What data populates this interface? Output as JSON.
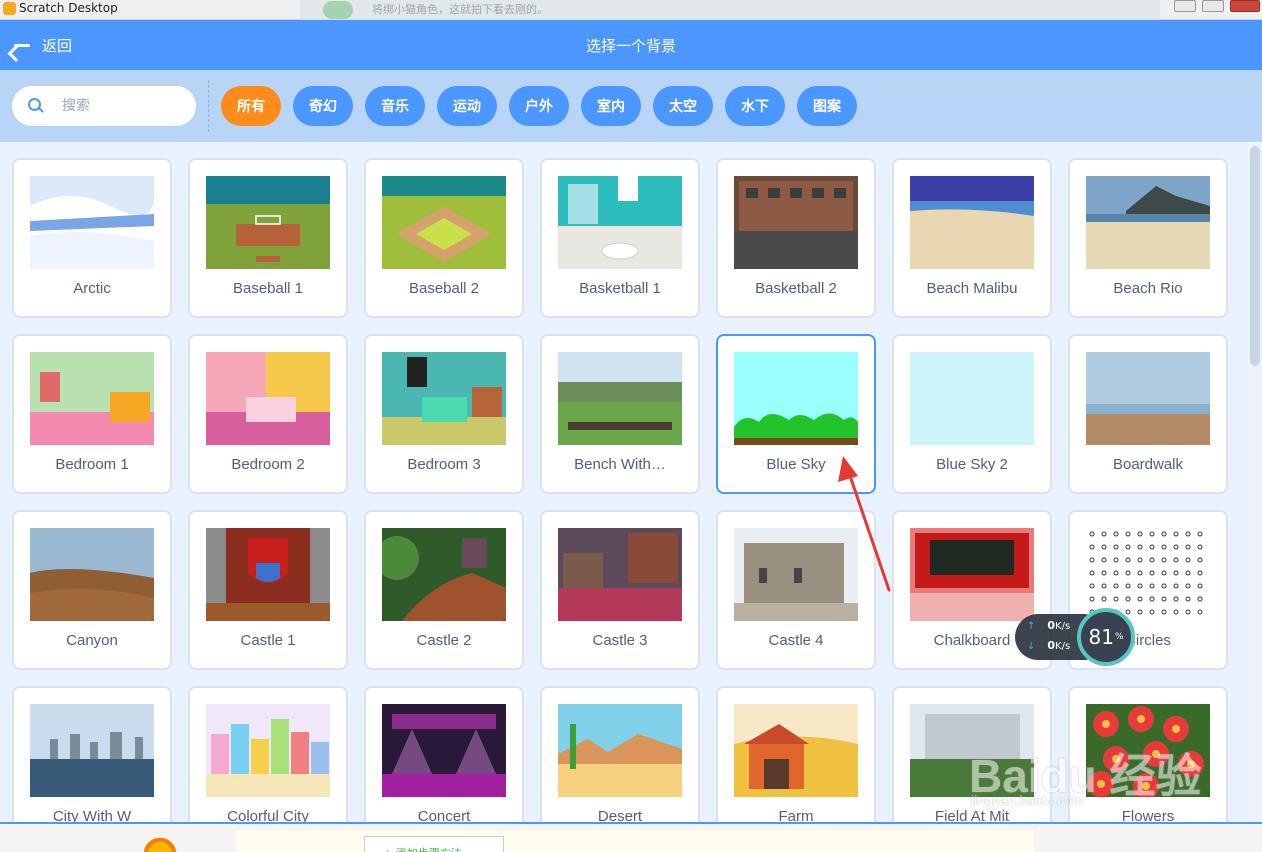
{
  "window": {
    "title": "Scratch Desktop",
    "ghost_text": "将绑小猫角色，这就拍下看去刚的。"
  },
  "header": {
    "back_label": "返回",
    "title": "选择一个背景"
  },
  "search": {
    "placeholder": "搜索"
  },
  "tags": [
    {
      "label": "所有",
      "active": true
    },
    {
      "label": "奇幻"
    },
    {
      "label": "音乐"
    },
    {
      "label": "运动"
    },
    {
      "label": "户外"
    },
    {
      "label": "室内"
    },
    {
      "label": "太空"
    },
    {
      "label": "水下"
    },
    {
      "label": "图案"
    }
  ],
  "backdrops": [
    {
      "name": "Arctic",
      "theme": "arctic-icon"
    },
    {
      "name": "Baseball 1",
      "theme": "baseball-field-icon"
    },
    {
      "name": "Baseball 2",
      "theme": "baseball-diamond-icon"
    },
    {
      "name": "Basketball 1",
      "theme": "basketball-court-icon"
    },
    {
      "name": "Basketball 2",
      "theme": "basketball-building-icon"
    },
    {
      "name": "Beach Malibu",
      "theme": "beach-icon"
    },
    {
      "name": "Beach Rio",
      "theme": "beach-mountain-icon"
    },
    {
      "name": "Bedroom 1",
      "theme": "bedroom-icon"
    },
    {
      "name": "Bedroom 2",
      "theme": "bedroom-pink-icon"
    },
    {
      "name": "Bedroom 3",
      "theme": "bedroom-teal-icon"
    },
    {
      "name": "Bench With…",
      "theme": "bench-icon"
    },
    {
      "name": "Blue Sky",
      "theme": "blue-sky-icon",
      "selected": true
    },
    {
      "name": "Blue Sky 2",
      "theme": "blue-sky-plain-icon"
    },
    {
      "name": "Boardwalk",
      "theme": "boardwalk-icon"
    },
    {
      "name": "Canyon",
      "theme": "canyon-icon"
    },
    {
      "name": "Castle 1",
      "theme": "castle-shield-icon"
    },
    {
      "name": "Castle 2",
      "theme": "castle-forest-icon"
    },
    {
      "name": "Castle 3",
      "theme": "castle-hall-icon"
    },
    {
      "name": "Castle 4",
      "theme": "castle-stone-icon"
    },
    {
      "name": "Chalkboard",
      "theme": "chalkboard-icon"
    },
    {
      "name": "Circles",
      "theme": "circles-pattern-icon"
    },
    {
      "name": "City With W",
      "theme": "city-water-icon"
    },
    {
      "name": "Colorful City",
      "theme": "colorful-city-icon"
    },
    {
      "name": "Concert",
      "theme": "concert-stage-icon"
    },
    {
      "name": "Desert",
      "theme": "desert-icon"
    },
    {
      "name": "Farm",
      "theme": "farm-barn-icon"
    },
    {
      "name": "Field At Mit",
      "theme": "field-building-icon"
    },
    {
      "name": "Flowers",
      "theme": "flowers-icon"
    }
  ],
  "netmon": {
    "up": "0",
    "up_unit": "K/s",
    "down": "0",
    "down_unit": "K/s",
    "percent": "81",
    "percent_unit": "%"
  },
  "bottom": {
    "add_step": "+ 添加步骤方法"
  },
  "watermark": {
    "text": "Baidu 经验",
    "sub": "jingyan.baidu.com"
  },
  "colors": {
    "header": "#4c97ff",
    "filterbar": "#b8d4f7",
    "active_tag": "#ff8c1a",
    "tag": "#4c97ff",
    "selected_border": "#4c97ff",
    "annotation_arrow": "#e53935"
  }
}
